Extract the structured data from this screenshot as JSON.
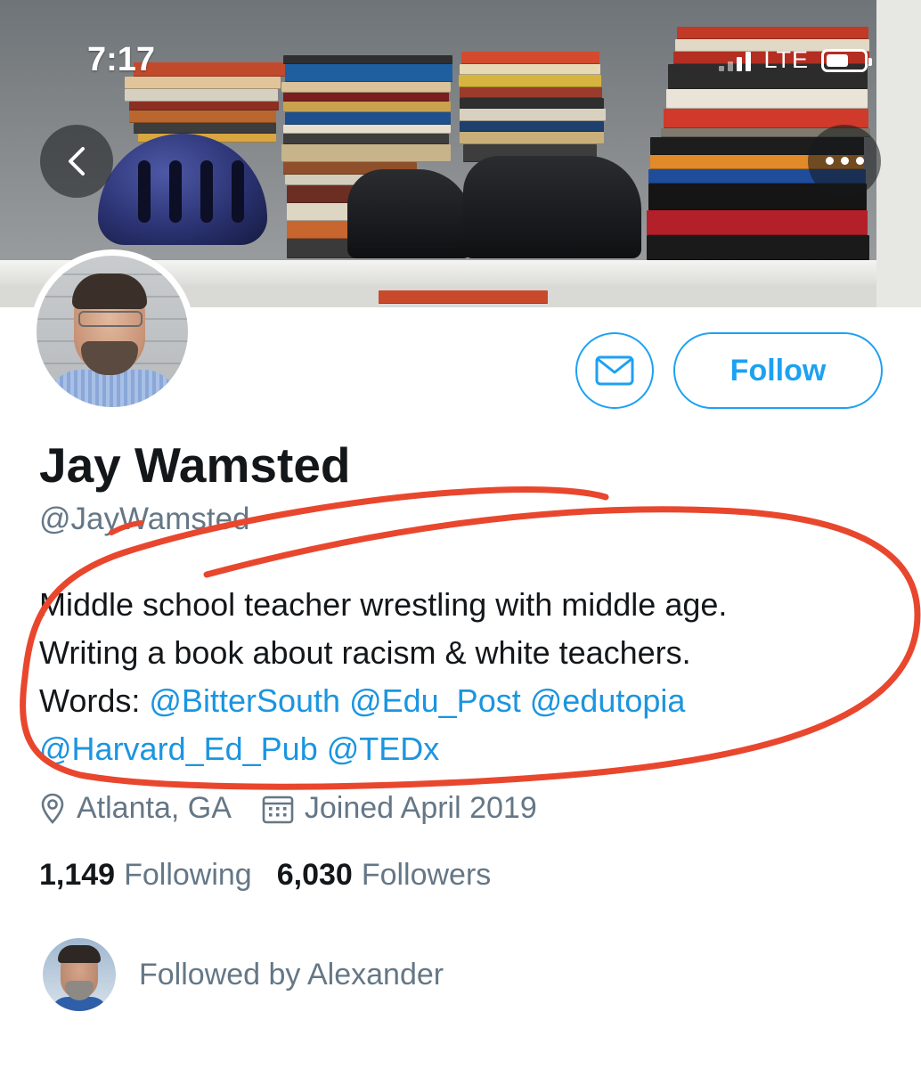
{
  "status_bar": {
    "time": "7:17",
    "network": "LTE"
  },
  "header": {
    "back_icon": "chevron-left-icon",
    "more_icon": "more-horizontal-icon"
  },
  "profile": {
    "name": "Jay Wamsted",
    "handle": "@JayWamsted",
    "bio_line1": "Middle school teacher wrestling with middle age.",
    "bio_line2": "Writing a book about racism & white teachers.",
    "bio_words_label": "Words:",
    "mentions": [
      "@BitterSouth",
      "@Edu_Post",
      "@edutopia",
      "@Harvard_Ed_Pub",
      "@TEDx"
    ],
    "location": "Atlanta, GA",
    "joined": "Joined April 2019",
    "following_count": "1,149",
    "following_label": "Following",
    "followers_count": "6,030",
    "followers_label": "Followers",
    "followed_by": "Followed by Alexander"
  },
  "actions": {
    "message_icon": "mail-icon",
    "follow_label": "Follow"
  },
  "colors": {
    "accent": "#1da1f2",
    "mention": "#1b95e0",
    "secondary_text": "#657786",
    "annotation": "#e8472e"
  }
}
